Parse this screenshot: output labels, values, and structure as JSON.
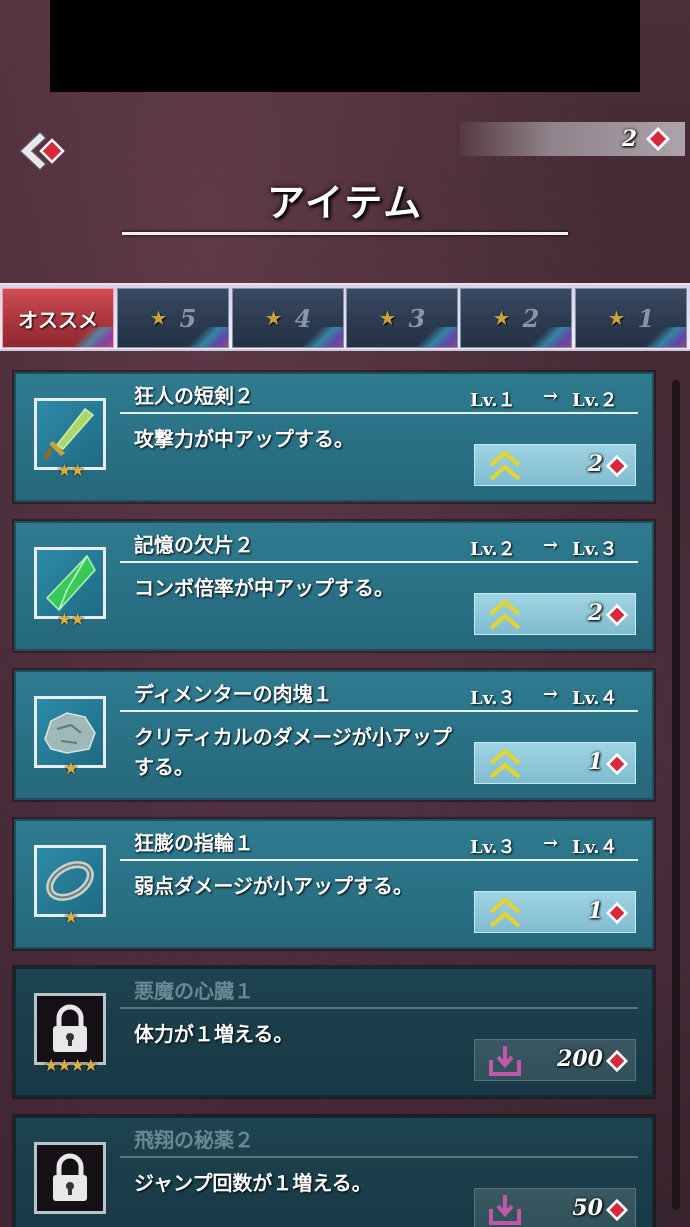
{
  "header": {
    "title": "アイテム",
    "currency_amount": "2"
  },
  "tabs": [
    {
      "label": "オススメ",
      "active": true
    },
    {
      "label": "5",
      "star": "★"
    },
    {
      "label": "4",
      "star": "★"
    },
    {
      "label": "3",
      "star": "★"
    },
    {
      "label": "2",
      "star": "★"
    },
    {
      "label": "1",
      "star": "★"
    }
  ],
  "items": [
    {
      "name": "狂人の短剣２",
      "stars": "★★",
      "lv_from": "Lv.１",
      "lv_arrow": "→",
      "lv_to": "Lv.２",
      "desc": "攻撃力が中アップする。",
      "cost": "2",
      "icon": "dagger-icon",
      "locked": false
    },
    {
      "name": "記憶の欠片２",
      "stars": "★★",
      "lv_from": "Lv.２",
      "lv_arrow": "→",
      "lv_to": "Lv.３",
      "desc": "コンボ倍率が中アップする。",
      "cost": "2",
      "icon": "crystal-shard-icon",
      "locked": false
    },
    {
      "name": "ディメンターの肉塊１",
      "stars": "★",
      "lv_from": "Lv.３",
      "lv_arrow": "→",
      "lv_to": "Lv.４",
      "desc": "クリティカルのダメージが小アップする。",
      "cost": "1",
      "icon": "rock-chunk-icon",
      "locked": false
    },
    {
      "name": "狂膨の指輪１",
      "stars": "★",
      "lv_from": "Lv.３",
      "lv_arrow": "→",
      "lv_to": "Lv.４",
      "desc": "弱点ダメージが小アップする。",
      "cost": "1",
      "icon": "ring-icon",
      "locked": false
    },
    {
      "name": "悪魔の心臓１",
      "stars": "★★★★",
      "desc": "体力が１増える。",
      "cost": "200",
      "icon": "lock-icon",
      "locked": true
    },
    {
      "name": "飛翔の秘薬２",
      "stars": "",
      "desc": "ジャンプ回数が１増える。",
      "cost": "50",
      "icon": "lock-icon",
      "locked": true
    }
  ],
  "colors": {
    "card_bg": "#2f7b90",
    "locked_card_bg": "#1d4450",
    "active_tab": "#d04c54",
    "gem_red": "#d8283c",
    "star_gold": "#d9b341",
    "upgrade_chevron": "#e6d42a",
    "unlock_icon": "#c057a8"
  }
}
